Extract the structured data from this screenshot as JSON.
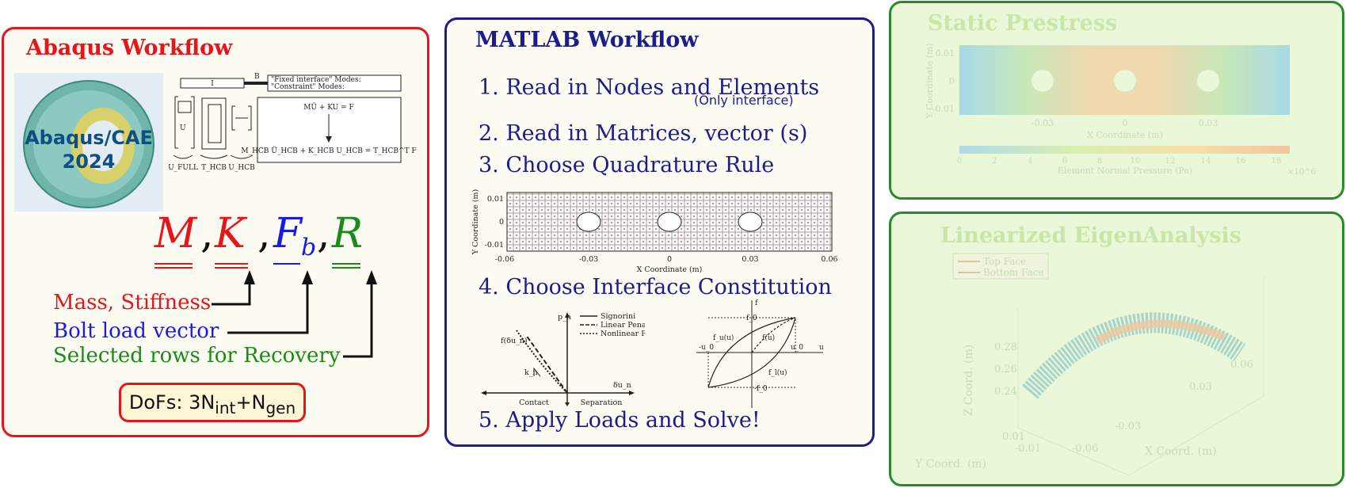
{
  "abaqus": {
    "title": "Abaqus Workflow",
    "logo_line1": "Abaqus/CAE",
    "logo_line2": "2024",
    "hcb": {
      "interface_label": "I",
      "boundary_label": "B",
      "modes_fixed": "\"Fixed interface\" Modes:",
      "modes_constraint": "\"Constraint\" Modes:",
      "eq_top": "MÜ + KU = F",
      "eq_bottom": "M_HCB Ü_HCB + K_HCB U_HCB = T_HCB^T F",
      "u_full": "U_FULL",
      "t_hcb": "T_HCB",
      "u_hcb": "U_HCB"
    },
    "matrices": [
      "M",
      "K",
      "F",
      "R"
    ],
    "fb_subscript": "b",
    "labels": [
      {
        "text": "Mass, Stiffness",
        "color": "#e8141b"
      },
      {
        "text": "Bolt load vector",
        "color": "#1a1ae6"
      },
      {
        "text": "Selected rows for Recovery",
        "color": "#1a8a1a"
      }
    ],
    "dofs_prefix": "DoFs: 3N",
    "dofs_sub1": "int",
    "dofs_mid": "+N",
    "dofs_sub2": "gen"
  },
  "matlab": {
    "title": "MATLAB Workflow",
    "steps": [
      "1. Read in Nodes and Elements",
      "2. Read in Matrices, vector (s)",
      "3. Choose Quadrature Rule",
      "4. Choose Interface Constitution",
      "5. Apply Loads and Solve!"
    ],
    "step1_note": "(Only interface)",
    "mesh_plot": {
      "xlabel": "X Coordinate (m)",
      "ylabel": "Y Coordinate (m)",
      "xticks": [
        "-0.06",
        "-0.03",
        "0",
        "0.03",
        "0.06"
      ],
      "yticks": [
        "0.01",
        "0",
        "-0.01"
      ]
    },
    "constitution_plot": {
      "legend": [
        "Signorini",
        "Linear Penalty",
        "Nonlinear Penalty"
      ],
      "yaxis": "p_n",
      "curve_label": "f(δu_n)",
      "slope_label": "k_n",
      "xaxis": "δu_n",
      "contact": "Contact",
      "separation": "Separation"
    },
    "hysteresis_plot": {
      "f_label": "f",
      "u_label": "u",
      "f0_pos": "f_0",
      "f0_neg": "-f_0",
      "u0_pos": "u_0",
      "u0_neg": "-u_0",
      "branch_u": "f_u(u)",
      "branch_mid": "f(u)",
      "branch_l": "f_l(u)"
    }
  },
  "static": {
    "title": "Static Prestress",
    "ylabel": "Y Coordinate (m)",
    "xlabel": "X Coordinate (m)",
    "yticks": [
      "0.01",
      "0",
      "-0.01"
    ],
    "xticks": [
      "-0.03",
      "0",
      "0.03"
    ],
    "colorbar_ticks": [
      "0",
      "2",
      "4",
      "6",
      "8",
      "10",
      "12",
      "14",
      "16",
      "18"
    ],
    "colorbar_label": "Element Normal Pressure (Pa)",
    "colorbar_exponent": "×10^6"
  },
  "eigen": {
    "title": "Linearized EigenAnalysis",
    "legend": [
      "Top Face",
      "Bottom Face"
    ],
    "zlabel": "Z Coord. (m)",
    "xlabel": "X Coord. (m)",
    "ylabel": "Y Coord. (m)",
    "zticks": [
      "0.28",
      "0.26",
      "0.24"
    ],
    "xticks": [
      "-0.06",
      "-0.03",
      "0.03",
      "0.06"
    ],
    "yticks": [
      "0.01",
      "-0.01"
    ]
  }
}
